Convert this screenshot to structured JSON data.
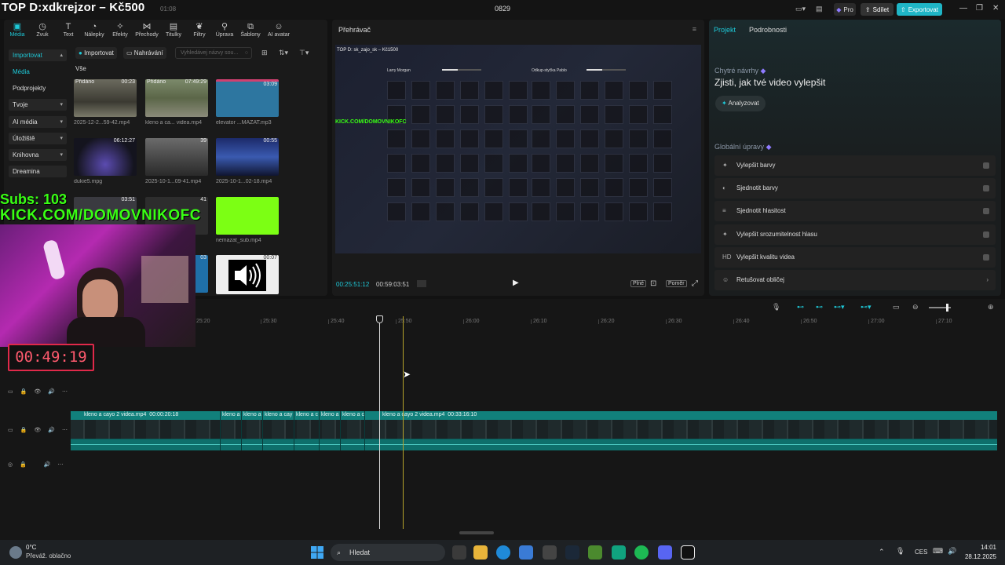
{
  "titlebar": {
    "stream_title": "TOP D:xdkrejzor – Kč500",
    "faint_time": "01:08",
    "project_name": "0829",
    "pro_label": "Pro",
    "share_label": "Sdílet",
    "export_label": "Exportovat"
  },
  "tools": [
    "Média",
    "Zvuk",
    "Text",
    "Nálepky",
    "Efekty",
    "Přechody",
    "Titulky",
    "Filtry",
    "Úprava",
    "Šablony",
    "AI avatar"
  ],
  "sidenav": {
    "import": "Importovat",
    "media": "Média",
    "subprojects": "Podprojekty",
    "yours": "Tvoje",
    "ai_media": "AI média",
    "storage": "Úložiště",
    "library": "Knihovna",
    "dreamina": "Dreamina"
  },
  "media": {
    "import_btn": "Importovat",
    "record_btn": "Nahrávání",
    "search_placeholder": "Vyhledávej názvy sou...",
    "filter_all": "Vše",
    "items": [
      {
        "name": "2025-12-2...59-42.mp4",
        "duration": "00:23",
        "badge": "Přidáno"
      },
      {
        "name": "kleno a ca... videa.mp4",
        "duration": "07:49:29",
        "badge": "Přidáno"
      },
      {
        "name": "elevator ...MAZAT.mp3",
        "duration": "03:09",
        "badge": ""
      },
      {
        "name": "dukie5.mpg",
        "duration": "06:12:27",
        "badge": ""
      },
      {
        "name": "2025-10-1...09-41.mp4",
        "duration": "39",
        "badge": ""
      },
      {
        "name": "2025-10-1...02-18.mp4",
        "duration": "00:55",
        "badge": ""
      },
      {
        "name": "",
        "duration": "03:51",
        "badge": ""
      },
      {
        "name": "",
        "duration": "41",
        "badge": ""
      },
      {
        "name": "nemazat_sub.mp4",
        "duration": "",
        "badge": ""
      },
      {
        "name": "",
        "duration": "03",
        "badge": ""
      },
      {
        "name": "",
        "duration": "00:07",
        "badge": ""
      }
    ]
  },
  "player": {
    "title": "Přehrávač",
    "game_title": "TOP D: sk_zajo_sk – Kč1500",
    "left_inv_label": "Larry Morgan",
    "right_inv_label": "Odkup-styčka Pablo",
    "overlay_kick": "KICK.COM/DOMOVNIKOFC",
    "current_time": "00:25:51:12",
    "total_time": "00:59:03:51",
    "btn_full": "Plné",
    "btn_ratio": "Poměr"
  },
  "right": {
    "tab_project": "Projekt",
    "tab_details": "Podrobnosti",
    "smart_title": "Chytré návrhy",
    "smart_sub": "Zjisti, jak tvé video vylepšit",
    "analyze": "Analyzovat",
    "global_title": "Globální úpravy",
    "adjustments": [
      {
        "icon": "✦",
        "label": "Vylepšit barvy"
      },
      {
        "icon": "◐",
        "label": "Sjednotit barvy"
      },
      {
        "icon": "≡",
        "label": "Sjednotit hlasitost"
      },
      {
        "icon": "✦",
        "label": "Vylepšit srozumitelnost hlasu"
      },
      {
        "icon": "HD",
        "label": "Vylepšit kvalitu videa"
      },
      {
        "icon": "☺",
        "label": "Retušovat obličej"
      }
    ]
  },
  "timeline": {
    "ruler": [
      "25:20",
      "25:30",
      "25:40",
      "25:50",
      "26:00",
      "26:10",
      "26:20",
      "26:30",
      "26:40",
      "26:50",
      "27:00",
      "27:10"
    ],
    "clip_main_label": "kleno a cayo 2 videa.mp4",
    "clip_main_time": "00:00:20:18",
    "clip_short_1": "kleno a",
    "clip_short_2": "kleno a",
    "clip_short_3": "kleno a cay",
    "clip_short_4": "kleno a c",
    "clip_short_5": "kleno a",
    "clip_short_6": "kleno a c",
    "clip_last_label": "kleno a cayo 2 videa.mp4",
    "clip_last_time": "00:33:16:10"
  },
  "overlay": {
    "subs": "Subs: 103",
    "kick": "KICK.COM/DOMOVNIKOFC",
    "timer": "00:49:19"
  },
  "taskbar": {
    "temp": "0°C",
    "weather": "Převáž. oblačno",
    "search": "Hledat",
    "lang": "CES",
    "time": "14:01",
    "date": "28.12.2025"
  },
  "colors": {
    "accent": "#1ec9d8",
    "export": "#1fb5c6",
    "clip": "#0d5d5a",
    "overlay_green": "#39ff14",
    "timer_red": "#e0294a"
  }
}
